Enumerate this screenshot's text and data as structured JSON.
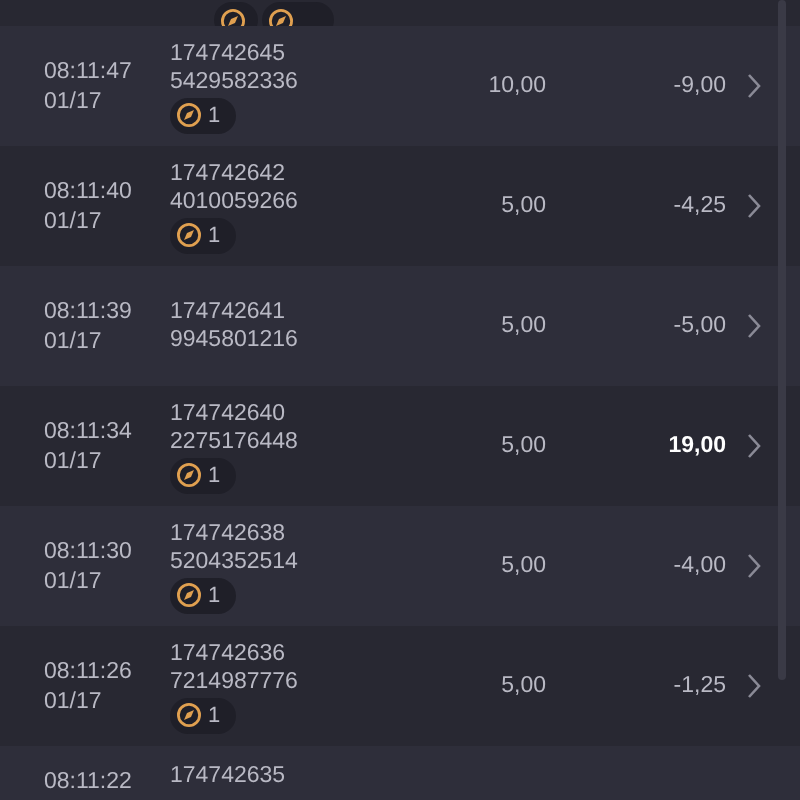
{
  "rows": [
    {
      "time": "08:11:47",
      "date": "01/17",
      "id_line1": "174742645",
      "id_line2": "5429582336",
      "badge": "1",
      "amount": "10,00",
      "result": "-9,00",
      "kind": "loss"
    },
    {
      "time": "08:11:40",
      "date": "01/17",
      "id_line1": "174742642",
      "id_line2": "4010059266",
      "badge": "1",
      "amount": "5,00",
      "result": "-4,25",
      "kind": "loss"
    },
    {
      "time": "08:11:39",
      "date": "01/17",
      "id_line1": "174742641",
      "id_line2": "9945801216",
      "amount": "5,00",
      "result": "-5,00",
      "kind": "loss"
    },
    {
      "time": "08:11:34",
      "date": "01/17",
      "id_line1": "174742640",
      "id_line2": "2275176448",
      "badge": "1",
      "amount": "5,00",
      "result": "19,00",
      "kind": "win"
    },
    {
      "time": "08:11:30",
      "date": "01/17",
      "id_line1": "174742638",
      "id_line2": "5204352514",
      "badge": "1",
      "amount": "5,00",
      "result": "-4,00",
      "kind": "loss"
    },
    {
      "time": "08:11:26",
      "date": "01/17",
      "id_line1": "174742636",
      "id_line2": "7214987776",
      "badge": "1",
      "amount": "5,00",
      "result": "-1,25",
      "kind": "loss"
    }
  ],
  "partial_row": {
    "time": "08:11:22",
    "id_line1": "174742635"
  }
}
